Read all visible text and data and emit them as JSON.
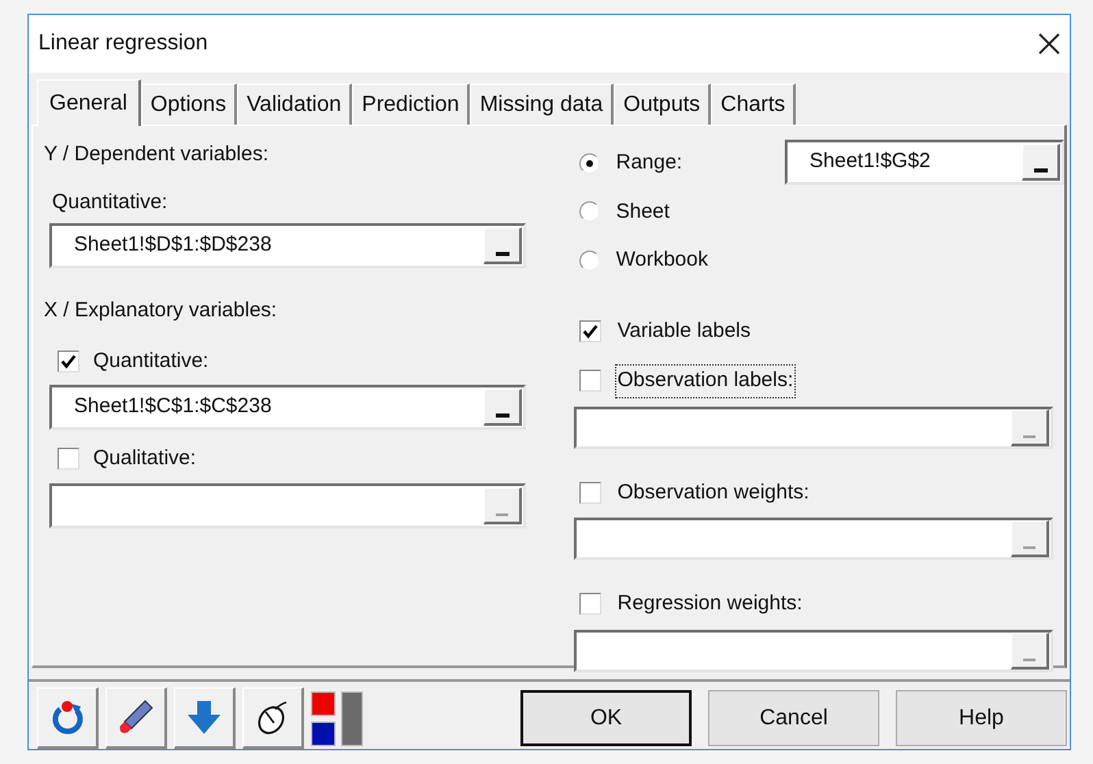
{
  "window": {
    "title": "Linear regression"
  },
  "tabs": [
    {
      "label": "General",
      "selected": true
    },
    {
      "label": "Options",
      "selected": false
    },
    {
      "label": "Validation",
      "selected": false
    },
    {
      "label": "Prediction",
      "selected": false
    },
    {
      "label": "Missing data",
      "selected": false
    },
    {
      "label": "Outputs",
      "selected": false
    },
    {
      "label": "Charts",
      "selected": false
    }
  ],
  "y_section": {
    "heading": "Y / Dependent variables:",
    "label": "Quantitative:",
    "field": {
      "value": "Sheet1!$D$1:$D$238",
      "disabled": false
    }
  },
  "x_section": {
    "heading": "X / Explanatory variables:",
    "items": [
      {
        "label": "Quantitative:",
        "checked": true,
        "field": {
          "value": "Sheet1!$C$1:$C$238",
          "disabled": false
        }
      },
      {
        "label": "Qualitative:",
        "checked": false,
        "field": {
          "disabled": true
        }
      }
    ]
  },
  "range_options": [
    {
      "label": "Range:",
      "selected": true
    },
    {
      "label": "Sheet",
      "selected": false
    },
    {
      "label": "Workbook",
      "selected": false
    }
  ],
  "range_field": {
    "value": "Sheet1!$G$2",
    "disabled": false
  },
  "options": [
    {
      "label": "Variable labels",
      "checked": true,
      "focused": false
    },
    {
      "label": "Observation labels:",
      "checked": false,
      "focused": true,
      "field": {
        "disabled": true
      }
    },
    {
      "label": "Observation weights:",
      "checked": false,
      "focused": false,
      "field": {
        "disabled": true
      }
    },
    {
      "label": "Regression weights:",
      "checked": false,
      "focused": false,
      "field": {
        "disabled": true
      }
    }
  ],
  "toolbar": [
    {
      "kind": "reset"
    },
    {
      "kind": "erase"
    },
    {
      "kind": "down"
    },
    {
      "kind": "mouse"
    },
    {
      "kind": "colors"
    }
  ],
  "buttons": [
    "OK",
    "Cancel",
    "Help"
  ]
}
